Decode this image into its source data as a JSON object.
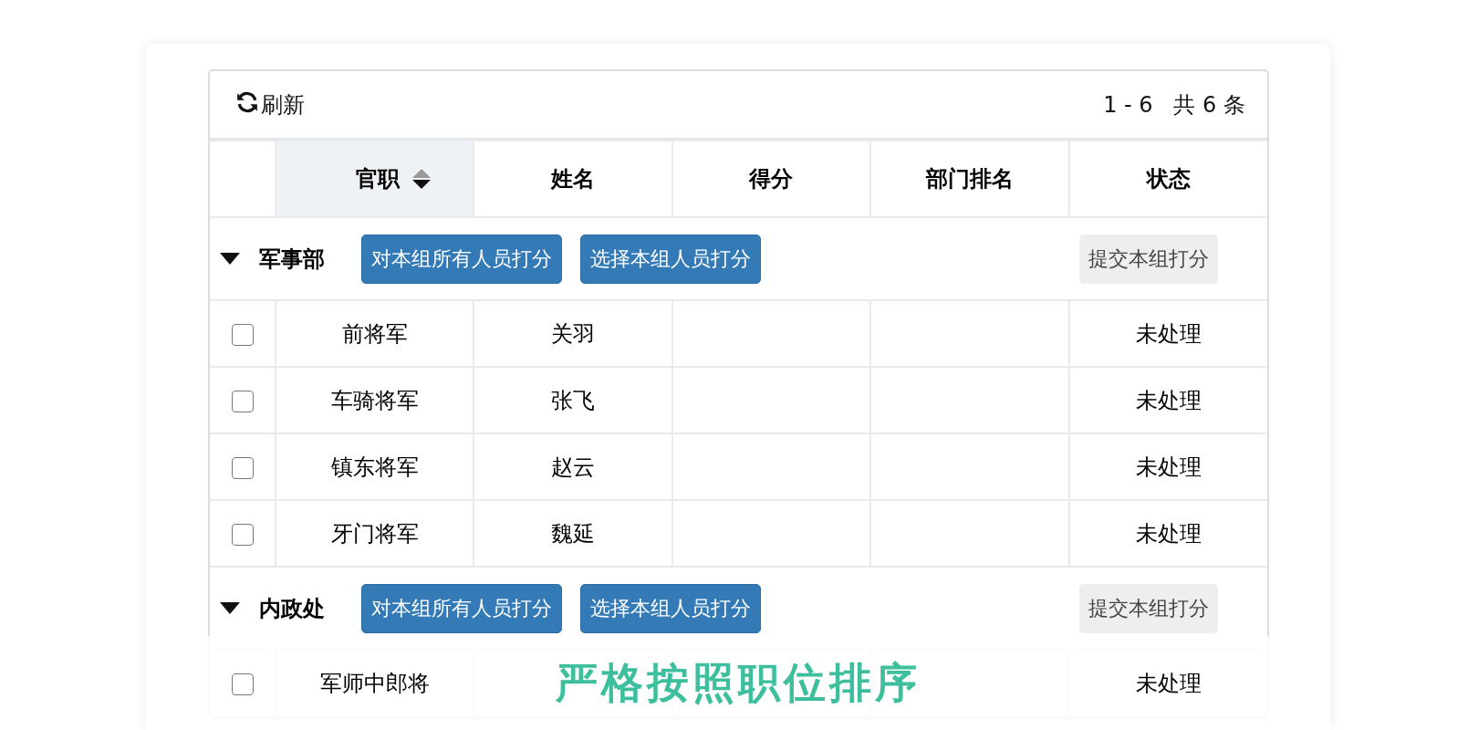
{
  "toolbar": {
    "refresh_label": "刷新",
    "pagination": "1 - 6   共 6 条"
  },
  "columns": [
    {
      "label": "官职",
      "sorted": true
    },
    {
      "label": "姓名",
      "sorted": false
    },
    {
      "label": "得分",
      "sorted": false
    },
    {
      "label": "部门排名",
      "sorted": false
    },
    {
      "label": "状态",
      "sorted": false
    }
  ],
  "groups": [
    {
      "name": "军事部",
      "expanded": true,
      "actions": [
        "对本组所有人员打分",
        "选择本组人员打分"
      ],
      "submit": {
        "label": "提交本组打分",
        "disabled": true
      },
      "rows": [
        {
          "title": "前将军",
          "name": "关羽",
          "status": "未处理",
          "checked": false
        },
        {
          "title": "车骑将军",
          "name": "张飞",
          "status": "未处理",
          "checked": false
        },
        {
          "title": "镇东将军",
          "name": "赵云",
          "status": "未处理",
          "checked": false
        },
        {
          "title": "牙门将军",
          "name": "魏延",
          "status": "未处理",
          "checked": false
        }
      ]
    },
    {
      "name": "内政处",
      "expanded": true,
      "actions": [
        "对本组所有人员打分",
        "选择本组人员打分"
      ],
      "submit": {
        "label": "提交本组打分",
        "disabled": true
      },
      "rows": [
        {
          "title": "军师中郎将",
          "status": "未处理",
          "checked": false
        }
      ]
    }
  ],
  "caption": "严格按照职位排序"
}
